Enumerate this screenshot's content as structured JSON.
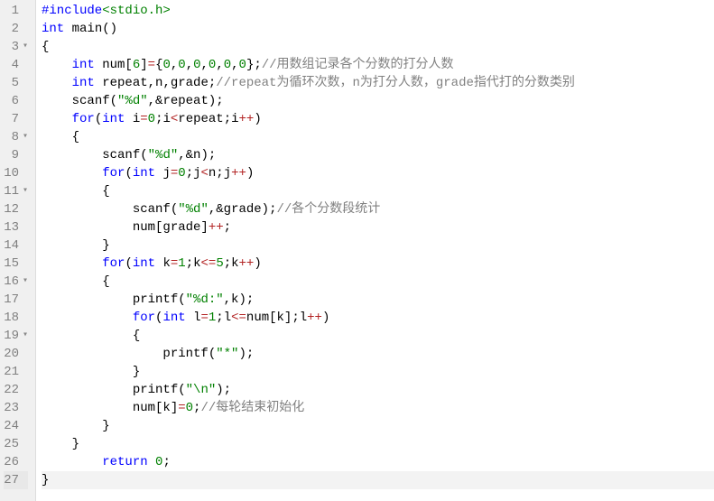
{
  "editor": {
    "highlight_line": 27,
    "fold_lines": [
      3,
      8,
      11,
      16,
      19
    ],
    "lines": [
      {
        "n": 1,
        "tokens": [
          {
            "t": "#include",
            "c": "tok-include"
          },
          {
            "t": "<stdio.h>",
            "c": "tok-header"
          }
        ]
      },
      {
        "n": 2,
        "tokens": [
          {
            "t": "int",
            "c": "tok-type"
          },
          {
            "t": " ",
            "c": ""
          },
          {
            "t": "main",
            "c": "tok-func"
          },
          {
            "t": "()",
            "c": "tok-punct"
          }
        ]
      },
      {
        "n": 3,
        "tokens": [
          {
            "t": "{",
            "c": "tok-brace"
          }
        ]
      },
      {
        "n": 4,
        "tokens": [
          {
            "t": "    ",
            "c": ""
          },
          {
            "t": "int",
            "c": "tok-type"
          },
          {
            "t": " num[",
            "c": "tok-ident"
          },
          {
            "t": "6",
            "c": "tok-number"
          },
          {
            "t": "]",
            "c": "tok-ident"
          },
          {
            "t": "=",
            "c": "tok-op"
          },
          {
            "t": "{",
            "c": "tok-brace"
          },
          {
            "t": "0",
            "c": "tok-number"
          },
          {
            "t": ",",
            "c": "tok-punct"
          },
          {
            "t": "0",
            "c": "tok-number"
          },
          {
            "t": ",",
            "c": "tok-punct"
          },
          {
            "t": "0",
            "c": "tok-number"
          },
          {
            "t": ",",
            "c": "tok-punct"
          },
          {
            "t": "0",
            "c": "tok-number"
          },
          {
            "t": ",",
            "c": "tok-punct"
          },
          {
            "t": "0",
            "c": "tok-number"
          },
          {
            "t": ",",
            "c": "tok-punct"
          },
          {
            "t": "0",
            "c": "tok-number"
          },
          {
            "t": "};",
            "c": "tok-brace"
          },
          {
            "t": "//用数组记录各个分数的打分人数",
            "c": "tok-comment"
          }
        ]
      },
      {
        "n": 5,
        "tokens": [
          {
            "t": "    ",
            "c": ""
          },
          {
            "t": "int",
            "c": "tok-type"
          },
          {
            "t": " repeat,n,grade;",
            "c": "tok-ident"
          },
          {
            "t": "//repeat为循环次数，n为打分人数，grade指代打的分数类别",
            "c": "tok-comment"
          }
        ]
      },
      {
        "n": 6,
        "tokens": [
          {
            "t": "    ",
            "c": ""
          },
          {
            "t": "scanf(",
            "c": "tok-func"
          },
          {
            "t": "\"%d\"",
            "c": "tok-string"
          },
          {
            "t": ",&repeat);",
            "c": "tok-ident"
          }
        ]
      },
      {
        "n": 7,
        "tokens": [
          {
            "t": "    ",
            "c": ""
          },
          {
            "t": "for",
            "c": "tok-keyword"
          },
          {
            "t": "(",
            "c": "tok-punct"
          },
          {
            "t": "int",
            "c": "tok-type"
          },
          {
            "t": " i",
            "c": "tok-ident"
          },
          {
            "t": "=",
            "c": "tok-op"
          },
          {
            "t": "0",
            "c": "tok-number"
          },
          {
            "t": ";i",
            "c": "tok-ident"
          },
          {
            "t": "<",
            "c": "tok-op"
          },
          {
            "t": "repeat;i",
            "c": "tok-ident"
          },
          {
            "t": "++",
            "c": "tok-op"
          },
          {
            "t": ")",
            "c": "tok-punct"
          }
        ]
      },
      {
        "n": 8,
        "tokens": [
          {
            "t": "    {",
            "c": "tok-brace"
          }
        ]
      },
      {
        "n": 9,
        "tokens": [
          {
            "t": "        ",
            "c": ""
          },
          {
            "t": "scanf(",
            "c": "tok-func"
          },
          {
            "t": "\"%d\"",
            "c": "tok-string"
          },
          {
            "t": ",&n);",
            "c": "tok-ident"
          }
        ]
      },
      {
        "n": 10,
        "tokens": [
          {
            "t": "        ",
            "c": ""
          },
          {
            "t": "for",
            "c": "tok-keyword"
          },
          {
            "t": "(",
            "c": "tok-punct"
          },
          {
            "t": "int",
            "c": "tok-type"
          },
          {
            "t": " j",
            "c": "tok-ident"
          },
          {
            "t": "=",
            "c": "tok-op"
          },
          {
            "t": "0",
            "c": "tok-number"
          },
          {
            "t": ";j",
            "c": "tok-ident"
          },
          {
            "t": "<",
            "c": "tok-op"
          },
          {
            "t": "n;j",
            "c": "tok-ident"
          },
          {
            "t": "++",
            "c": "tok-op"
          },
          {
            "t": ")",
            "c": "tok-punct"
          }
        ]
      },
      {
        "n": 11,
        "tokens": [
          {
            "t": "        {",
            "c": "tok-brace"
          }
        ]
      },
      {
        "n": 12,
        "tokens": [
          {
            "t": "            ",
            "c": ""
          },
          {
            "t": "scanf(",
            "c": "tok-func"
          },
          {
            "t": "\"%d\"",
            "c": "tok-string"
          },
          {
            "t": ",&grade);",
            "c": "tok-ident"
          },
          {
            "t": "//各个分数段统计",
            "c": "tok-comment"
          }
        ]
      },
      {
        "n": 13,
        "tokens": [
          {
            "t": "            num[grade]",
            "c": "tok-ident"
          },
          {
            "t": "++",
            "c": "tok-op"
          },
          {
            "t": ";",
            "c": "tok-punct"
          }
        ]
      },
      {
        "n": 14,
        "tokens": [
          {
            "t": "        }",
            "c": "tok-brace"
          }
        ]
      },
      {
        "n": 15,
        "tokens": [
          {
            "t": "        ",
            "c": ""
          },
          {
            "t": "for",
            "c": "tok-keyword"
          },
          {
            "t": "(",
            "c": "tok-punct"
          },
          {
            "t": "int",
            "c": "tok-type"
          },
          {
            "t": " k",
            "c": "tok-ident"
          },
          {
            "t": "=",
            "c": "tok-op"
          },
          {
            "t": "1",
            "c": "tok-number"
          },
          {
            "t": ";k",
            "c": "tok-ident"
          },
          {
            "t": "<=",
            "c": "tok-op"
          },
          {
            "t": "5",
            "c": "tok-number"
          },
          {
            "t": ";k",
            "c": "tok-ident"
          },
          {
            "t": "++",
            "c": "tok-op"
          },
          {
            "t": ")",
            "c": "tok-punct"
          }
        ]
      },
      {
        "n": 16,
        "tokens": [
          {
            "t": "        {",
            "c": "tok-brace"
          }
        ]
      },
      {
        "n": 17,
        "tokens": [
          {
            "t": "            ",
            "c": ""
          },
          {
            "t": "printf(",
            "c": "tok-func"
          },
          {
            "t": "\"%d:\"",
            "c": "tok-string"
          },
          {
            "t": ",k);",
            "c": "tok-ident"
          }
        ]
      },
      {
        "n": 18,
        "tokens": [
          {
            "t": "            ",
            "c": ""
          },
          {
            "t": "for",
            "c": "tok-keyword"
          },
          {
            "t": "(",
            "c": "tok-punct"
          },
          {
            "t": "int",
            "c": "tok-type"
          },
          {
            "t": " l",
            "c": "tok-ident"
          },
          {
            "t": "=",
            "c": "tok-op"
          },
          {
            "t": "1",
            "c": "tok-number"
          },
          {
            "t": ";l",
            "c": "tok-ident"
          },
          {
            "t": "<=",
            "c": "tok-op"
          },
          {
            "t": "num[k];l",
            "c": "tok-ident"
          },
          {
            "t": "++",
            "c": "tok-op"
          },
          {
            "t": ")",
            "c": "tok-punct"
          }
        ]
      },
      {
        "n": 19,
        "tokens": [
          {
            "t": "            {",
            "c": "tok-brace"
          }
        ]
      },
      {
        "n": 20,
        "tokens": [
          {
            "t": "                ",
            "c": ""
          },
          {
            "t": "printf(",
            "c": "tok-func"
          },
          {
            "t": "\"*\"",
            "c": "tok-string"
          },
          {
            "t": ");",
            "c": "tok-punct"
          }
        ]
      },
      {
        "n": 21,
        "tokens": [
          {
            "t": "            }",
            "c": "tok-brace"
          }
        ]
      },
      {
        "n": 22,
        "tokens": [
          {
            "t": "            ",
            "c": ""
          },
          {
            "t": "printf(",
            "c": "tok-func"
          },
          {
            "t": "\"\\n\"",
            "c": "tok-string"
          },
          {
            "t": ");",
            "c": "tok-punct"
          }
        ]
      },
      {
        "n": 23,
        "tokens": [
          {
            "t": "            num[k]",
            "c": "tok-ident"
          },
          {
            "t": "=",
            "c": "tok-op"
          },
          {
            "t": "0",
            "c": "tok-number"
          },
          {
            "t": ";",
            "c": "tok-punct"
          },
          {
            "t": "//每轮结束初始化",
            "c": "tok-comment"
          }
        ]
      },
      {
        "n": 24,
        "tokens": [
          {
            "t": "        }",
            "c": "tok-brace"
          }
        ]
      },
      {
        "n": 25,
        "tokens": [
          {
            "t": "    }",
            "c": "tok-brace"
          }
        ]
      },
      {
        "n": 26,
        "tokens": [
          {
            "t": "        ",
            "c": ""
          },
          {
            "t": "return",
            "c": "tok-keyword"
          },
          {
            "t": " ",
            "c": ""
          },
          {
            "t": "0",
            "c": "tok-number"
          },
          {
            "t": ";",
            "c": "tok-punct"
          }
        ]
      },
      {
        "n": 27,
        "tokens": [
          {
            "t": "}",
            "c": "tok-brace"
          }
        ]
      }
    ]
  }
}
